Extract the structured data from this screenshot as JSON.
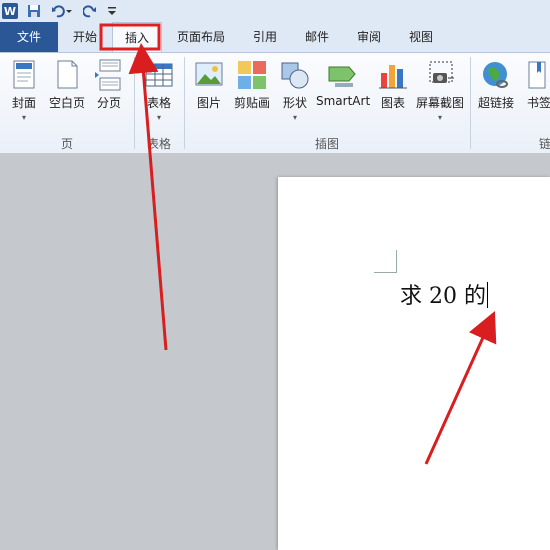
{
  "tabs": {
    "file": "文件",
    "home": "开始",
    "insert": "插入",
    "page_layout": "页面布局",
    "references": "引用",
    "mailings": "邮件",
    "review": "审阅",
    "view": "视图"
  },
  "ribbon": {
    "pages": {
      "cover": "封面",
      "blank": "空白页",
      "break": "分页",
      "group": "页"
    },
    "tables": {
      "table": "表格",
      "group": "表格"
    },
    "illustrations": {
      "picture": "图片",
      "clipart": "剪贴画",
      "shapes": "形状",
      "smartart": "SmartArt",
      "chart": "图表",
      "screenshot": "屏幕截图",
      "group": "插图"
    },
    "links": {
      "hyperlink": "超链接",
      "bookmark": "书签",
      "group": "链接"
    }
  },
  "document": {
    "text": "求 20 的"
  },
  "colors": {
    "accent": "#2b5797",
    "highlight": "#e02020",
    "arrow": "#d81e1e"
  }
}
